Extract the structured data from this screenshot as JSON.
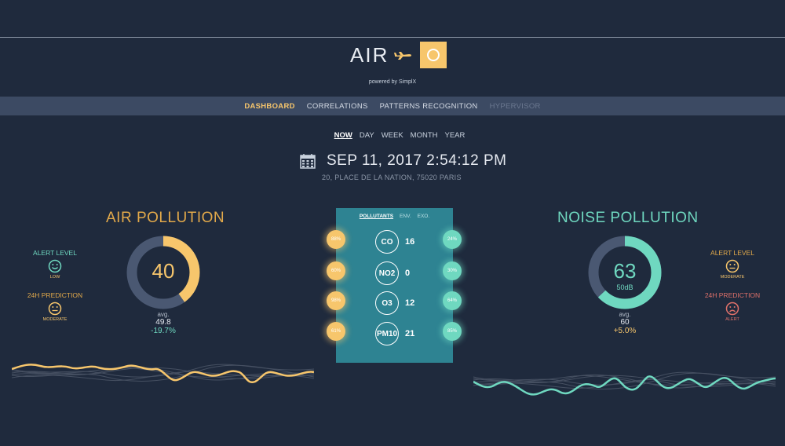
{
  "header": {
    "logo_left": "AIR",
    "powered_by": "powered by SimplX"
  },
  "nav": {
    "items": [
      {
        "label": "DASHBOARD",
        "state": "active"
      },
      {
        "label": "CORRELATIONS",
        "state": "normal"
      },
      {
        "label": "PATTERNS RECOGNITION",
        "state": "normal"
      },
      {
        "label": "HYPERVISOR",
        "state": "disabled"
      }
    ]
  },
  "periods": [
    "NOW",
    "DAY",
    "WEEK",
    "MONTH",
    "YEAR"
  ],
  "active_period": "NOW",
  "datetime": {
    "date": "SEP 11, 2017 2:54:12 PM",
    "address": "20, PLACE DE LA NATION, 75020 PARIS"
  },
  "air": {
    "title": "AIR POLLUTION",
    "alert_label": "ALERT LEVEL",
    "alert_status": "LOW",
    "prediction_label": "24H PREDICTION",
    "prediction_status": "MODERATE",
    "value": "40",
    "gauge_fraction": 0.4,
    "avg_label": "avg.",
    "avg_value": "49.8",
    "change": "-19.7%"
  },
  "noise": {
    "title": "NOISE POLLUTION",
    "alert_label": "ALERT LEVEL",
    "alert_status": "MODERATE",
    "prediction_label": "24H PREDICTION",
    "prediction_status": "ALERT",
    "value": "63",
    "unit": "50dB",
    "gauge_fraction": 0.63,
    "avg_label": "avg.",
    "avg_value": "60",
    "change": "+5.0%"
  },
  "panel": {
    "tabs": [
      {
        "label": "POLLUTANTS",
        "active": true
      },
      {
        "label": "ENV.",
        "active": false
      },
      {
        "label": "EXO.",
        "active": false
      }
    ],
    "pollutants": [
      {
        "name": "CO",
        "value": "16",
        "left_pct": "88%",
        "right_pct": "24%"
      },
      {
        "name": "NO2",
        "value": "0",
        "left_pct": "60%",
        "right_pct": "30%"
      },
      {
        "name": "O3",
        "value": "12",
        "left_pct": "98%",
        "right_pct": "64%"
      },
      {
        "name": "PM10",
        "value": "21",
        "left_pct": "61%",
        "right_pct": "85%"
      }
    ]
  },
  "colors": {
    "background": "#1f2a3d",
    "accent_yellow": "#f7c66c",
    "accent_green": "#6fd8c0",
    "alert_red": "#e0716a",
    "panel": "#2e8392",
    "navbar": "#3c4a63"
  }
}
